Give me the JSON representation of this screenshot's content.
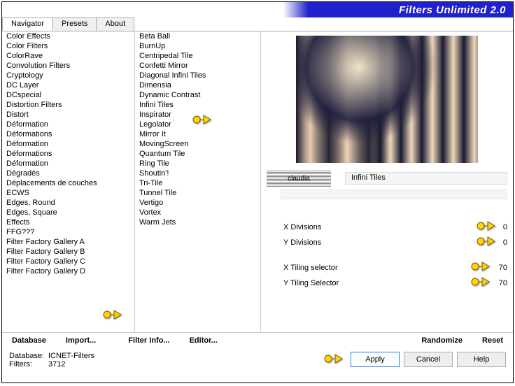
{
  "app_title": "Filters Unlimited 2.0",
  "tabs": [
    "Navigator",
    "Presets",
    "About"
  ],
  "active_tab": 0,
  "categories": [
    "Color Effects",
    "Color Filters",
    "ColorRave",
    "Convolution Filters",
    "Cryptology",
    "DC Layer",
    "DCspecial",
    "Distortion Filters",
    "Distort",
    "Déformation",
    "Déformations",
    "Déformation",
    "Déformations",
    "Déformation",
    "Dégradés",
    "Déplacements de couches",
    "ECWS",
    "Edges, Round",
    "Edges, Square",
    "Effects",
    "FFG???",
    "Filter Factory Gallery A",
    "Filter Factory Gallery B",
    "Filter Factory Gallery C",
    "Filter Factory Gallery D"
  ],
  "effects": [
    "Beta Ball",
    "BurnUp",
    "Centripedal Tile",
    "Confetti Mirror",
    "Diagonal Infini Tiles",
    "Dimensia",
    "Dynamic Contrast",
    "Infini Tiles",
    "Inspirator",
    "Legolator",
    "Mirror It",
    "MovingScreen",
    "Quantum Tile",
    "Ring Tile",
    "Shoutin'!",
    "Tri-Tile",
    "Tunnel Tile",
    "Vertigo",
    "Vortex",
    "Warm Jets"
  ],
  "effect_logo_text": "claudia",
  "current_effect": "Infini Tiles",
  "params": [
    {
      "label": "X Divisions",
      "value": 0
    },
    {
      "label": "Y Divisions",
      "value": 0
    },
    {
      "label": "X Tiling selector",
      "value": 70
    },
    {
      "label": "Y Tiling Selector",
      "value": 70
    }
  ],
  "toolbar": {
    "database": "Database",
    "import": "Import...",
    "filter_info": "Filter Info...",
    "editor": "Editor...",
    "randomize": "Randomize",
    "reset": "Reset"
  },
  "footer": {
    "db_label": "Database:",
    "db_value": "ICNET-Filters",
    "filters_label": "Filters:",
    "filters_value": "3712"
  },
  "buttons": {
    "apply": "Apply",
    "cancel": "Cancel",
    "help": "Help"
  }
}
